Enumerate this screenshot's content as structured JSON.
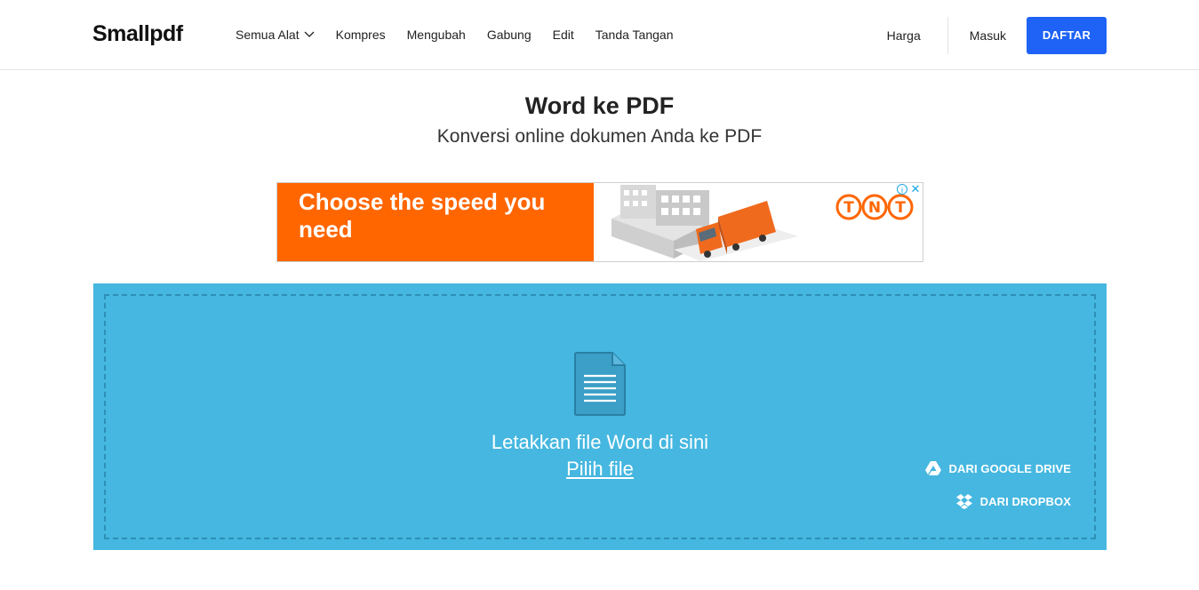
{
  "header": {
    "logo": "Smallpdf",
    "nav": [
      {
        "label": "Semua Alat",
        "has_dropdown": true
      },
      {
        "label": "Kompres"
      },
      {
        "label": "Mengubah"
      },
      {
        "label": "Gabung"
      },
      {
        "label": "Edit"
      },
      {
        "label": "Tanda Tangan"
      }
    ],
    "pricing": "Harga",
    "login": "Masuk",
    "signup": "DAFTAR",
    "accent_color": "#1e63f5"
  },
  "page": {
    "title": "Word ke PDF",
    "subtitle": "Konversi online dokumen Anda ke PDF"
  },
  "ad": {
    "headline_line1": "Choose the speed you",
    "headline_line2": "need",
    "brand": "TNT",
    "brand_color": "#ff6600"
  },
  "upload": {
    "background_color": "#45b7e0",
    "icon": "document-icon",
    "drop_text": "Letakkan file Word di sini",
    "choose_file": "Pilih file",
    "google_drive": "DARI GOOGLE DRIVE",
    "dropbox": "DARI DROPBOX"
  }
}
